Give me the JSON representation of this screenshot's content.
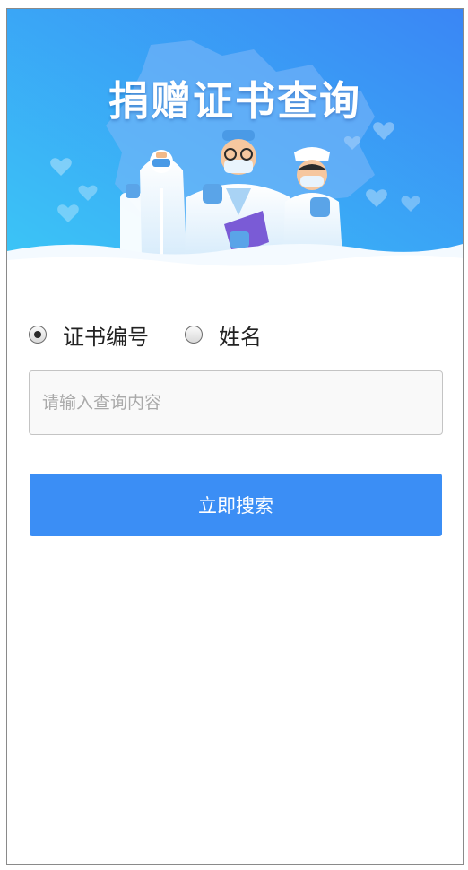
{
  "banner": {
    "title": "捐赠证书查询",
    "illustration": "medical-workers-illustration",
    "colors": {
      "gradient_start": "#3bc6f6",
      "gradient_end": "#3a86f5"
    }
  },
  "search_type": {
    "options": [
      {
        "label": "证书编号",
        "checked": true
      },
      {
        "label": "姓名",
        "checked": false
      }
    ]
  },
  "query": {
    "placeholder": "请输入查询内容",
    "value": ""
  },
  "search_button": {
    "label": "立即搜索",
    "color": "#3b8ef5"
  }
}
